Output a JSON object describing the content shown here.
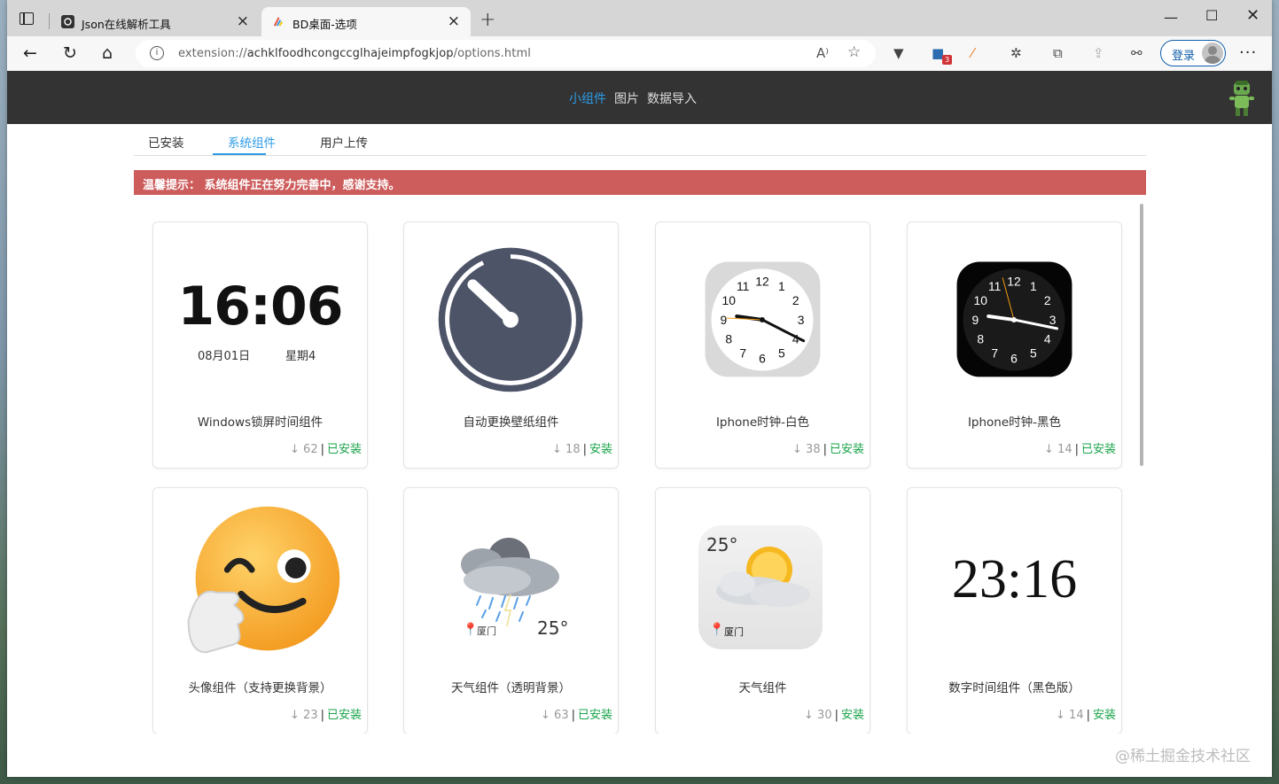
{
  "browser": {
    "tabs": [
      {
        "title": "Json在线解析工具"
      },
      {
        "title": "BD桌面-选项"
      }
    ],
    "url_prefix": "extension://",
    "url_main": "achklfoodhcongccglhajeimpfogkjop",
    "url_suffix": "/options.html",
    "login_label": "登录",
    "extension_badge": "3"
  },
  "header": {
    "nav": [
      {
        "label": "小组件",
        "active": true
      },
      {
        "label": "图片",
        "active": false
      },
      {
        "label": "数据导入",
        "active": false
      }
    ]
  },
  "subtabs": [
    {
      "label": "已安装"
    },
    {
      "label": "系统组件"
    },
    {
      "label": "用户上传"
    }
  ],
  "notice": "温馨提示： 系统组件正在努力完善中，感谢支持。",
  "cards": [
    {
      "name": "Windows锁屏时间组件",
      "downloads": "62",
      "status": "已安装",
      "preview": {
        "time": "16:06",
        "date": "08月01日",
        "weekday": "星期4"
      }
    },
    {
      "name": "自动更换壁纸组件",
      "downloads": "18",
      "status": "安装"
    },
    {
      "name": "Iphone时钟-白色",
      "downloads": "38",
      "status": "已安装"
    },
    {
      "name": "Iphone时钟-黑色",
      "downloads": "14",
      "status": "已安装"
    },
    {
      "name": "头像组件（支持更换背景）",
      "downloads": "23",
      "status": "已安装"
    },
    {
      "name": "天气组件（透明背景）",
      "downloads": "63",
      "status": "已安装",
      "preview": {
        "city": "厦门",
        "temp": "25°"
      }
    },
    {
      "name": "天气组件",
      "downloads": "30",
      "status": "安装",
      "preview": {
        "city": "厦门",
        "temp": "25°"
      }
    },
    {
      "name": "数字时间组件（黑色版）",
      "downloads": "14",
      "status": "安装",
      "preview": {
        "time": "23:16"
      }
    }
  ],
  "clock_numbers": [
    "12",
    "1",
    "2",
    "3",
    "4",
    "5",
    "6",
    "7",
    "8",
    "9",
    "10",
    "11"
  ],
  "watermark": "@稀土掘金技术社区",
  "colors": {
    "accent": "#2d9be6",
    "notice_bg": "#cd5c5c",
    "installed": "#1aa34a",
    "header_bg": "#333333"
  }
}
